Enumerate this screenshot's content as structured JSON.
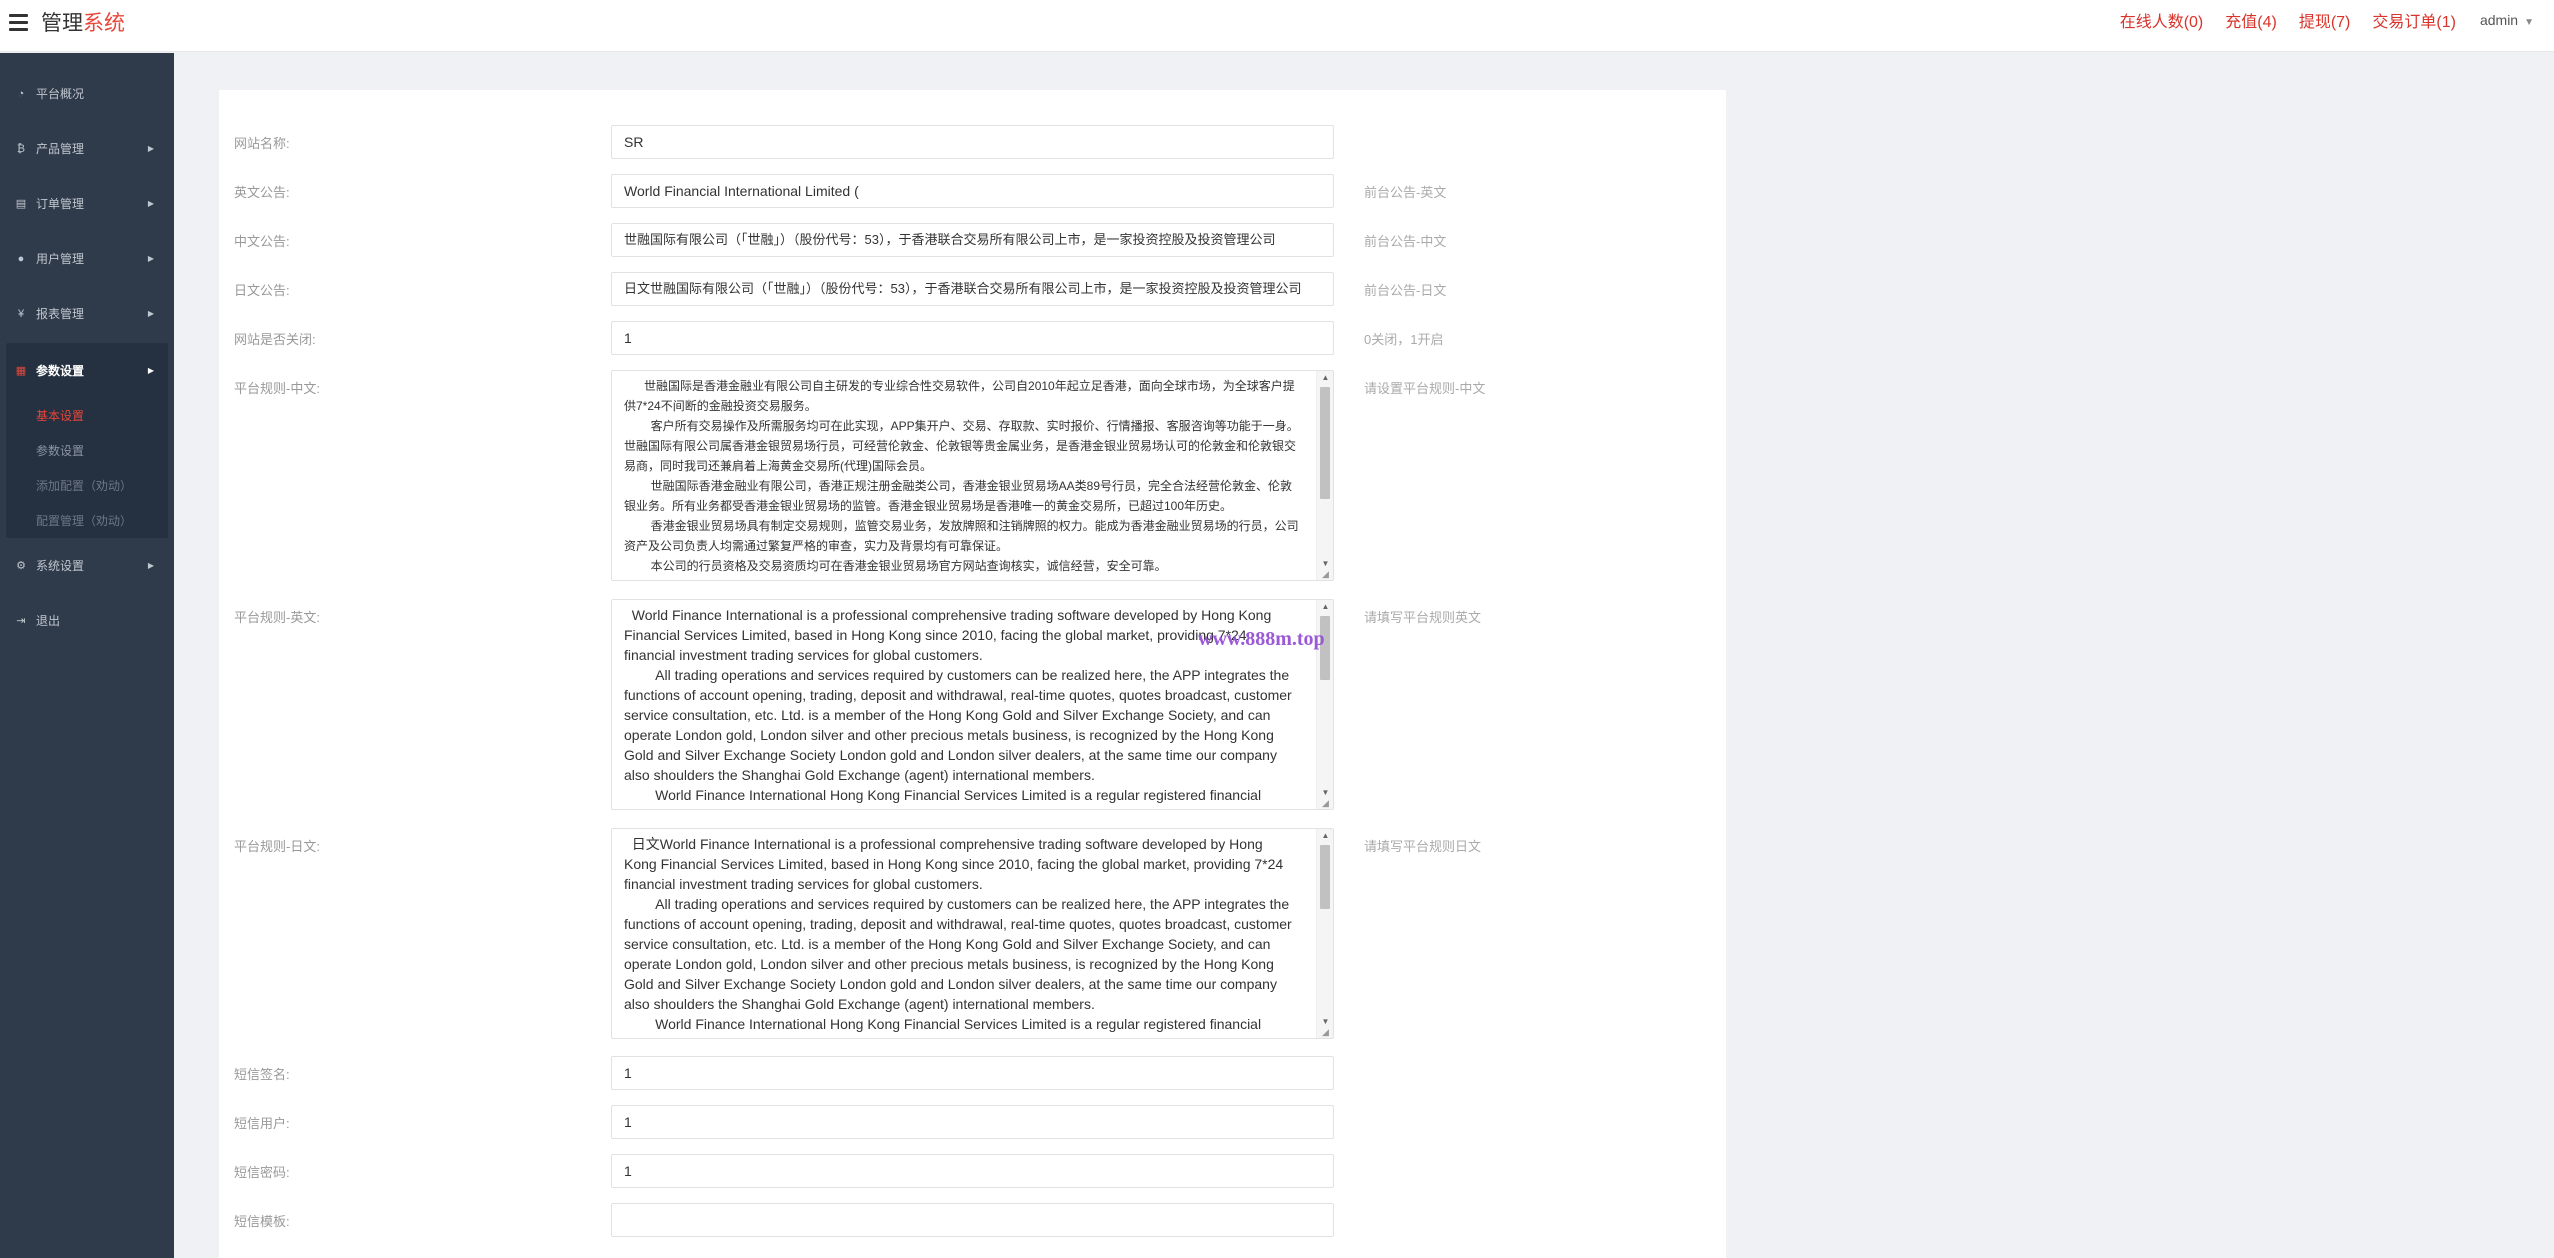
{
  "header": {
    "title_main": "管理",
    "title_accent": "系统",
    "links": [
      "在线人数(0)",
      "充值(4)",
      "提现(7)",
      "交易订单(1)"
    ],
    "user": "admin"
  },
  "sidebar": {
    "items": [
      {
        "label": "平台概况",
        "icon": "dashboard-icon",
        "glyph": "◔"
      },
      {
        "label": "产品管理",
        "icon": "bitcoin-icon",
        "glyph": "₿"
      },
      {
        "label": "订单管理",
        "icon": "order-icon",
        "glyph": "▤"
      },
      {
        "label": "用户管理",
        "icon": "user-icon",
        "glyph": "●"
      },
      {
        "label": "报表管理",
        "icon": "yen-icon",
        "glyph": "¥"
      },
      {
        "label": "参数设置",
        "icon": "params-icon",
        "glyph": "▦"
      },
      {
        "label": "系统设置",
        "icon": "cogs-icon",
        "glyph": "⚙"
      },
      {
        "label": "退出",
        "icon": "logout-icon",
        "glyph": "⇥"
      }
    ],
    "sub_items": [
      "基本设置",
      "参数设置",
      "添加配置（劝动）",
      "配置管理（劝动）"
    ]
  },
  "form": {
    "site_name": {
      "label": "网站名称:",
      "value": "SR"
    },
    "en_notice": {
      "label": "英文公告:",
      "value": "World Financial International Limited (",
      "hint": "前台公告-英文"
    },
    "cn_notice": {
      "label": "中文公告:",
      "value": "世融国际有限公司（「世融」）（股份代号：53），于香港联合交易所有限公司上市，是一家投资控股及投资管理公司",
      "hint": "前台公告-中文"
    },
    "jp_notice": {
      "label": "日文公告:",
      "value": "日文世融国际有限公司（「世融」）（股份代号：53），于香港联合交易所有限公司上市，是一家投资控股及投资管理公司",
      "hint": "前台公告-日文"
    },
    "site_closed": {
      "label": "网站是否关闭:",
      "value": "1",
      "hint": "0关闭，1开启"
    },
    "rules_cn": {
      "label": "平台规则-中文:",
      "hint": "请设置平台规则-中文",
      "value": "      世融国际是香港金融业有限公司自主研发的专业综合性交易软件，公司自2010年起立足香港，面向全球市场，为全球客户提供7*24不间断的金融投资交易服务。\n        客户所有交易操作及所需服务均可在此实现，APP集开户、交易、存取款、实时报价、行情播报、客服咨询等功能于一身。 世融国际有限公司属香港金银贸易场行员，可经营伦敦金、伦敦银等贵金属业务，是香港金银业贸易场认可的伦敦金和伦敦银交易商，同时我司还兼肩着上海黄金交易所(代理)国际会员。\n        世融国际香港金融业有限公司，香港正规注册金融类公司，香港金银业贸易场AA类89号行员，完全合法经营伦敦金、伦敦银业务。所有业务都受香港金银业贸易场的监管。香港金银业贸易场是香港唯一的黄金交易所，已超过100年历史。\n        香港金银业贸易场具有制定交易规则，监管交易业务，发放牌照和注销牌照的权力。能成为香港金融业贸易场的行员，公司资产及公司负责人均需通过繁复严格的审查，实力及背景均有可靠保证。\n        本公司的行员资格及交易资质均可在香港金银业贸易场官方网站查询核实，诚信经营，安全可靠。"
    },
    "rules_en": {
      "label": "平台规则-英文:",
      "hint": "请填写平台规则英文",
      "value": "  World Finance International is a professional comprehensive trading software developed by Hong Kong Financial Services Limited, based in Hong Kong since 2010, facing the global market, providing 7*24 financial investment trading services for global customers.\n        All trading operations and services required by customers can be realized here, the APP integrates the functions of account opening, trading, deposit and withdrawal, real-time quotes, quotes broadcast, customer service consultation, etc. Ltd. is a member of the Hong Kong Gold and Silver Exchange Society, and can operate London gold, London silver and other precious metals business, is recognized by the Hong Kong Gold and Silver Exchange Society London gold and London silver dealers, at the same time our company also shoulders the Shanghai Gold Exchange (agent) international members.\n        World Finance International Hong Kong Financial Services Limited is a regular registered financial company in Hong Kong."
    },
    "rules_jp": {
      "label": "平台规则-日文:",
      "hint": "请填写平台规则日文",
      "value": "  日文World Finance International is a professional comprehensive trading software developed by Hong Kong Financial Services Limited, based in Hong Kong since 2010, facing the global market, providing 7*24 financial investment trading services for global customers.\n        All trading operations and services required by customers can be realized here, the APP integrates the functions of account opening, trading, deposit and withdrawal, real-time quotes, quotes broadcast, customer service consultation, etc. Ltd. is a member of the Hong Kong Gold and Silver Exchange Society, and can operate London gold, London silver and other precious metals business, is recognized by the Hong Kong Gold and Silver Exchange Society London gold and London silver dealers, at the same time our company also shoulders the Shanghai Gold Exchange (agent) international members.\n        World Finance International Hong Kong Financial Services Limited is a regular registered financial company in Hong Kong."
    },
    "sms_sign": {
      "label": "短信签名:",
      "value": "1"
    },
    "sms_user": {
      "label": "短信用户:",
      "value": "1"
    },
    "sms_pass": {
      "label": "短信密码:",
      "value": "1"
    },
    "sms_tpl": {
      "label": "短信模板:",
      "value": ""
    }
  },
  "watermark": "www.888m.top"
}
